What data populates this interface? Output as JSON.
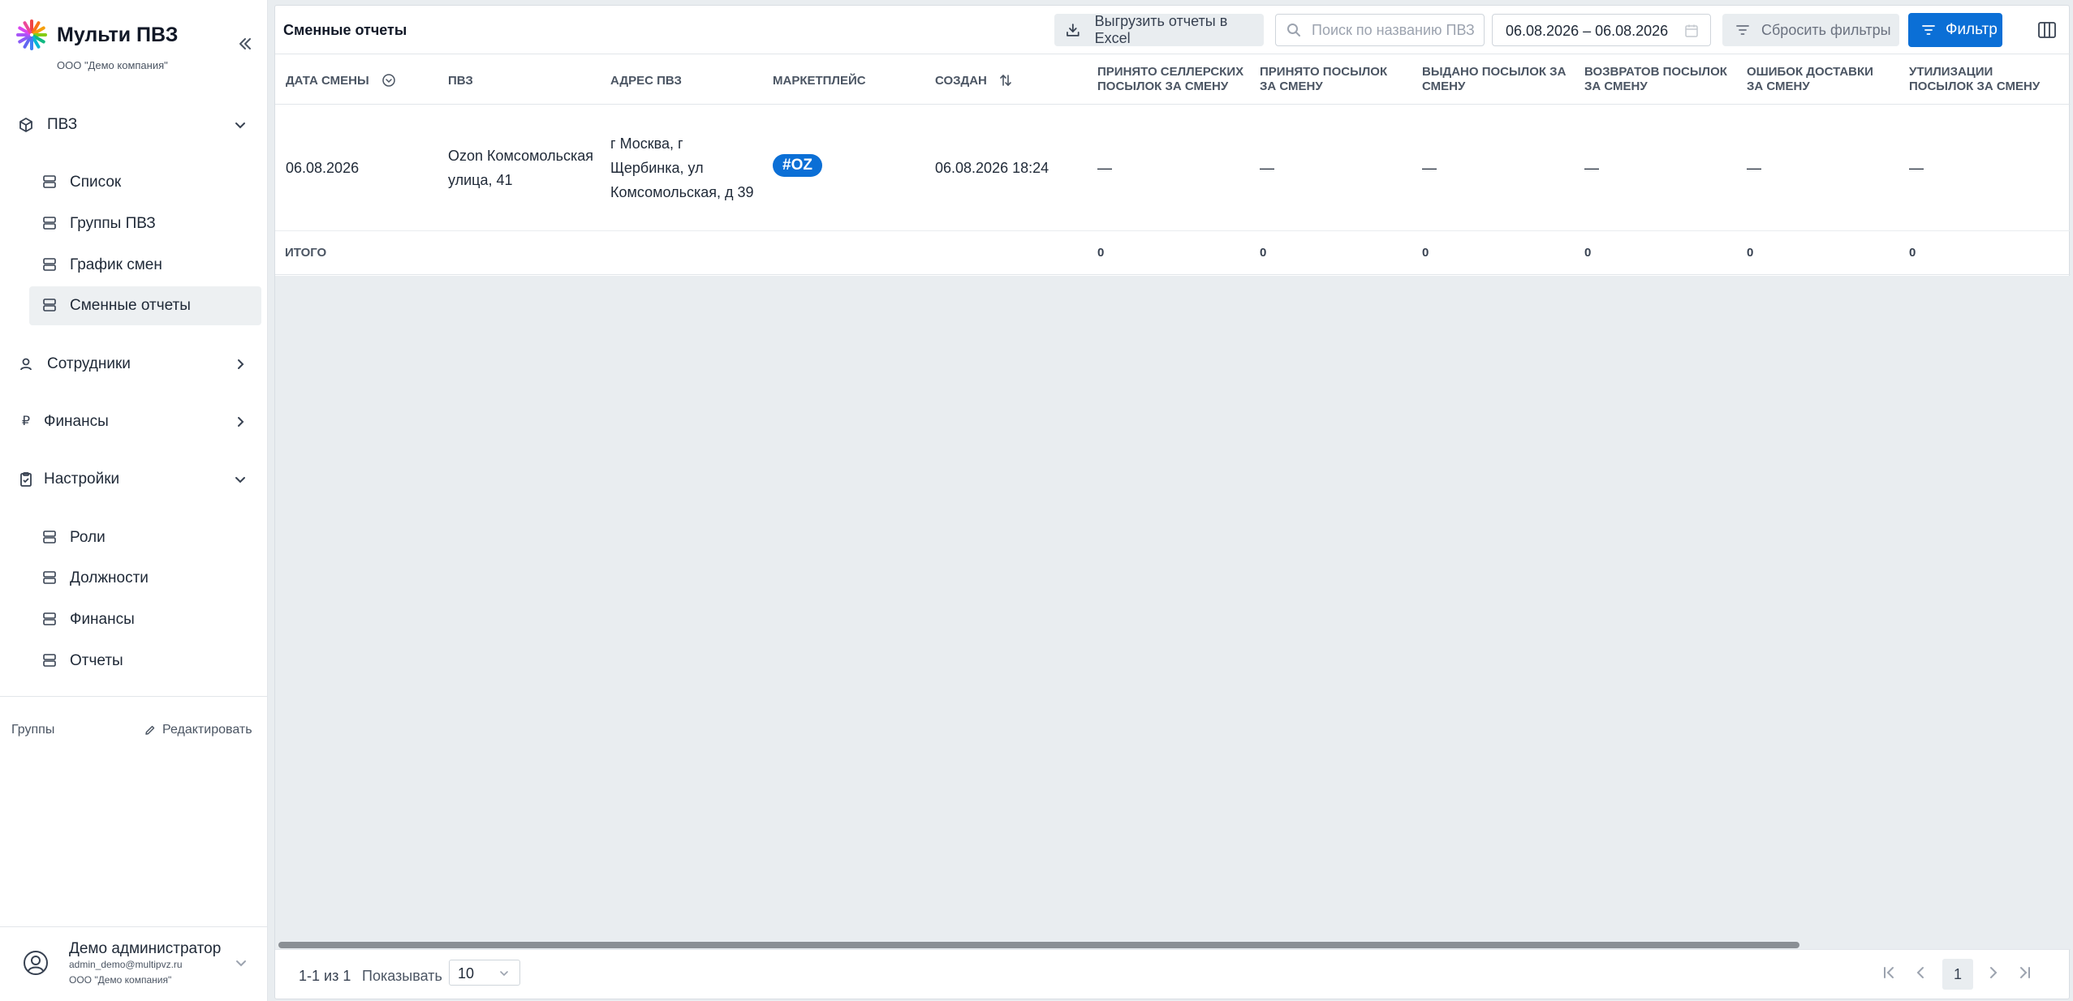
{
  "brand": {
    "title": "Мульти ПВЗ",
    "subtitle": "ООО \"Демо компания\"",
    "collapse_icon": "double-chevron-left-icon"
  },
  "nav": {
    "pvz": {
      "label": "ПВЗ",
      "icon": "box-icon",
      "expanded": true
    },
    "pvz_items": [
      {
        "label": "Список"
      },
      {
        "label": "Группы ПВЗ"
      },
      {
        "label": "График смен"
      },
      {
        "label": "Сменные отчеты",
        "active": true
      }
    ],
    "employees": {
      "label": "Сотрудники",
      "icon": "person-icon"
    },
    "finance": {
      "label": "Финансы",
      "icon": "ruble-icon"
    },
    "settings": {
      "label": "Настройки",
      "icon": "clipboard-icon",
      "expanded": true
    },
    "settings_items": [
      {
        "label": "Роли"
      },
      {
        "label": "Должности"
      },
      {
        "label": "Финансы"
      },
      {
        "label": "Отчеты"
      }
    ]
  },
  "groups": {
    "label": "Группы",
    "edit_label": "Редактировать"
  },
  "user": {
    "name": "Демо администратор",
    "email": "admin_demo@multipvz.ru",
    "org": "ООО \"Демо компания\""
  },
  "toolbar": {
    "title": "Сменные отчеты",
    "export_label": "Выгрузить отчеты в Excel",
    "search_placeholder": "Поиск по названию ПВЗ",
    "date_range": "06.08.2026 – 06.08.2026",
    "reset_label": "Сбросить фильтры",
    "filter_label": "Фильтр"
  },
  "table": {
    "columns": {
      "shift_date": "Дата смены",
      "pvz": "ПВЗ",
      "address": "Адрес ПВЗ",
      "marketplace": "Маркетплейс",
      "created": "Создан",
      "seller_line1": "Принято селлерских",
      "seller_line2": "посылок за смену",
      "accepted_line1": "Принято посылок",
      "accepted_line2": "за смену",
      "issued_line1": "Выдано посылок за",
      "issued_line2": "смену",
      "returns_line1": "Возвратов посылок",
      "returns_line2": "за смену",
      "errors_line1": "Ошибок доставки",
      "errors_line2": "за смену",
      "disposal_line1": "Утилизации",
      "disposal_line2": "посылок за смену"
    },
    "rows": [
      {
        "shift_date": "06.08.2026",
        "pvz_line1": "Ozon Комсомольская",
        "pvz_line2": "улица, 41",
        "address_line1": "г Москва, г",
        "address_line2": "Щербинка, ул",
        "address_line3": "Комсомольская, д 39",
        "marketplace": "#OZ",
        "created": "06.08.2026 18:24",
        "seller": "—",
        "accepted": "—",
        "issued": "—",
        "returns": "—",
        "errors": "—",
        "disposal": "—"
      }
    ],
    "total": {
      "label": "Итого",
      "seller": "0",
      "accepted": "0",
      "issued": "0",
      "returns": "0",
      "errors": "0",
      "disposal": "0"
    }
  },
  "pagination": {
    "range": "1-1 из 1",
    "show_label": "Показывать",
    "page_size": "10",
    "current_page": "1"
  },
  "colors": {
    "accent": "#0b6fd6",
    "background": "#e9edf0"
  }
}
